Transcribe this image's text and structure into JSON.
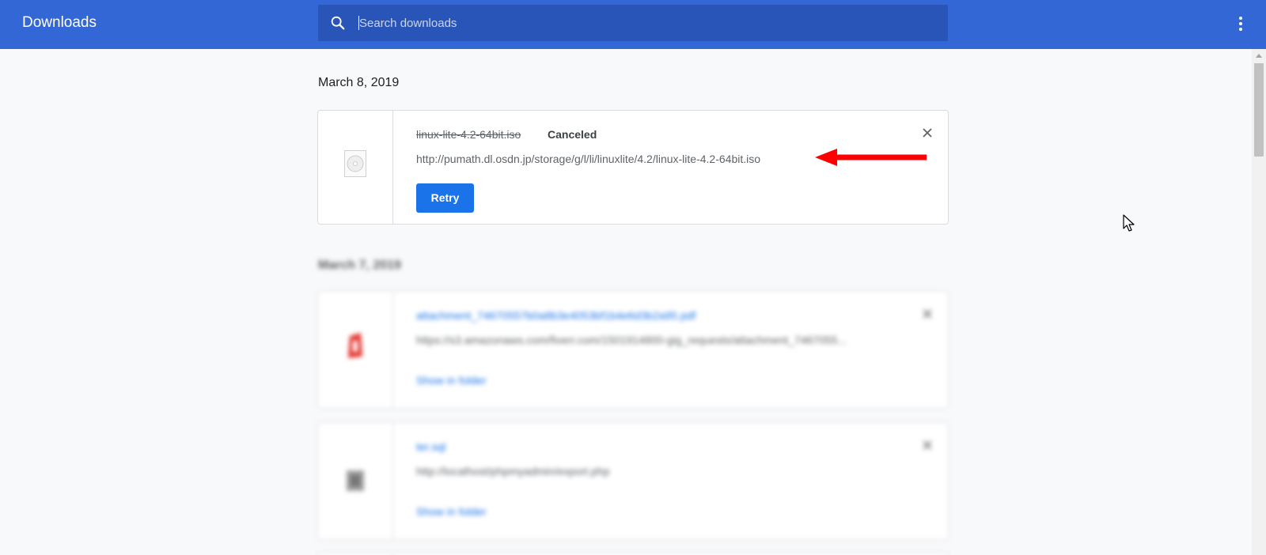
{
  "toolbar": {
    "title": "Downloads",
    "search_placeholder": "Search downloads"
  },
  "groups": [
    {
      "date": "March 8, 2019",
      "items": [
        {
          "file_name": "linux-lite-4.2-64bit.iso",
          "status": "Canceled",
          "url": "http://pumath.dl.osdn.jp/storage/g/l/li/linuxlite/4.2/linux-lite-4.2-64bit.iso",
          "action": "Retry"
        }
      ]
    },
    {
      "date": "March 7, 2019",
      "items": [
        {
          "file_name": "attachment_74670557b0a8b3e4053bf1b4e6d3b2a95.pdf",
          "url": "https://s3.amazonaws.com/fiverr.com/1501914800-gig_requests/attachment_7467055...",
          "action": "Show in folder"
        },
        {
          "file_name": "ter.sql",
          "url": "http://localhost/phpmyadmin/export.php",
          "action": "Show in folder"
        }
      ]
    }
  ],
  "icons": {
    "search": "search-icon",
    "menu": "more-vert-icon",
    "close": "close-icon",
    "annotation": "red-arrow-icon",
    "cursor": "mouse-cursor-icon"
  },
  "colors": {
    "toolbar": "#3367d6",
    "search_bar": "#2a55b8",
    "accent": "#1a73e8",
    "annotation": "#ff0000"
  }
}
